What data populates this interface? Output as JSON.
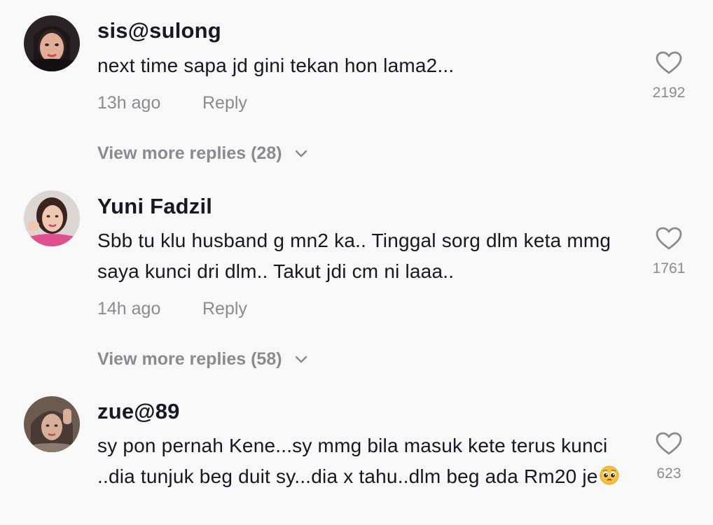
{
  "comments": [
    {
      "username": "sis@sulong",
      "text": "next time sapa jd gini tekan hon lama2...",
      "time": "13h ago",
      "reply_label": "Reply",
      "likes": "2192",
      "more_replies": "View more replies (28)"
    },
    {
      "username": "Yuni Fadzil",
      "text": "Sbb tu klu husband g mn2 ka.. Tinggal sorg dlm keta mmg saya kunci dri dlm.. Takut jdi cm ni laaa..",
      "time": "14h ago",
      "reply_label": "Reply",
      "likes": "1761",
      "more_replies": "View more replies (58)"
    },
    {
      "username": "zue@89",
      "text": "sy pon pernah Kene...sy mmg bila masuk kete terus kunci ..dia tunjuk beg duit sy...dia x tahu..dlm beg ada Rm20 je",
      "emoji": "pleading-face-emoji",
      "likes": "623"
    }
  ],
  "icons": {
    "like": "heart-outline-icon",
    "expand": "chevron-down-icon"
  },
  "colors": {
    "background": "#f8f8f8",
    "text": "#161823",
    "secondary": "#8a8b91"
  }
}
